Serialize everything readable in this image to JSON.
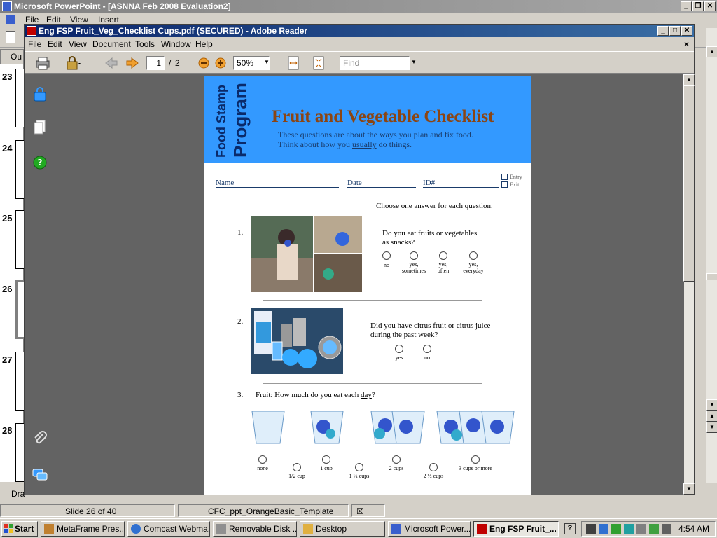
{
  "powerpoint": {
    "title": "Microsoft PowerPoint - [ASNNA Feb 2008 Evaluation2]",
    "menu_items": [
      "File",
      "Edit",
      "View",
      "Insert"
    ],
    "outline_tab": "Ou",
    "slide_numbers": [
      "23",
      "24",
      "25",
      "26",
      "27",
      "28"
    ],
    "active_slide": "26",
    "draw_label": "Dra",
    "status": {
      "slide_info": "Slide 26 of 40",
      "template": "CFC_ppt_OrangeBasic_Template"
    }
  },
  "reader": {
    "title": "Eng FSP Fruit_Veg_Checklist Cups.pdf (SECURED) - Adobe Reader",
    "menu_items": [
      "File",
      "Edit",
      "View",
      "Document",
      "Tools",
      "Window",
      "Help"
    ],
    "close_doc": "×",
    "toolbar": {
      "page_current": "1",
      "page_separator": "/",
      "page_total": "2",
      "zoom": "50%",
      "find_placeholder": "Find"
    }
  },
  "pdf": {
    "logo_line1": "Food Stamp",
    "logo_line2": "Program",
    "title": "Fruit and Vegetable Checklist",
    "subtitle_line1": "These questions are about the ways you plan and fix food.",
    "subtitle_line2_pre": "Think about how you ",
    "subtitle_line2_underlined": "usually",
    "subtitle_line2_post": " do things.",
    "fields": {
      "name": "Name",
      "date": "Date",
      "id": "ID#"
    },
    "checkboxes": {
      "entry": "Entry",
      "exit": "Exit"
    },
    "instruction": "Choose one answer for each question.",
    "q1": {
      "number": "1.",
      "text_line1": "Do you eat fruits or vegetables",
      "text_line2": "as snacks?",
      "options": [
        {
          "line1": "no",
          "line2": ""
        },
        {
          "line1": "yes,",
          "line2": "sometimes"
        },
        {
          "line1": "yes,",
          "line2": "often"
        },
        {
          "line1": "yes,",
          "line2": "everyday"
        }
      ]
    },
    "q2": {
      "number": "2.",
      "text_line1": "Did you have citrus fruit or citrus juice",
      "text_line2_pre": "during the past ",
      "text_line2_underlined": "week",
      "text_line2_post": "?",
      "options": [
        "yes",
        "no"
      ]
    },
    "q3": {
      "number": "3.",
      "text_pre": "Fruit:  How much do you eat each ",
      "text_underlined": "day",
      "text_post": "?",
      "options_upper": [
        "none",
        "1 cup",
        "2 cups",
        "3 cups or more"
      ],
      "options_lower": [
        "1/2 cup",
        "1 ½ cups",
        "2 ½ cups"
      ]
    }
  },
  "taskbar": {
    "start": "Start",
    "tasks": [
      "MetaFrame Pres...",
      "Comcast Webma...",
      "Removable Disk ...",
      "Desktop",
      "Microsoft Power...",
      "Eng FSP Fruit_..."
    ],
    "clock": "4:54 AM"
  }
}
